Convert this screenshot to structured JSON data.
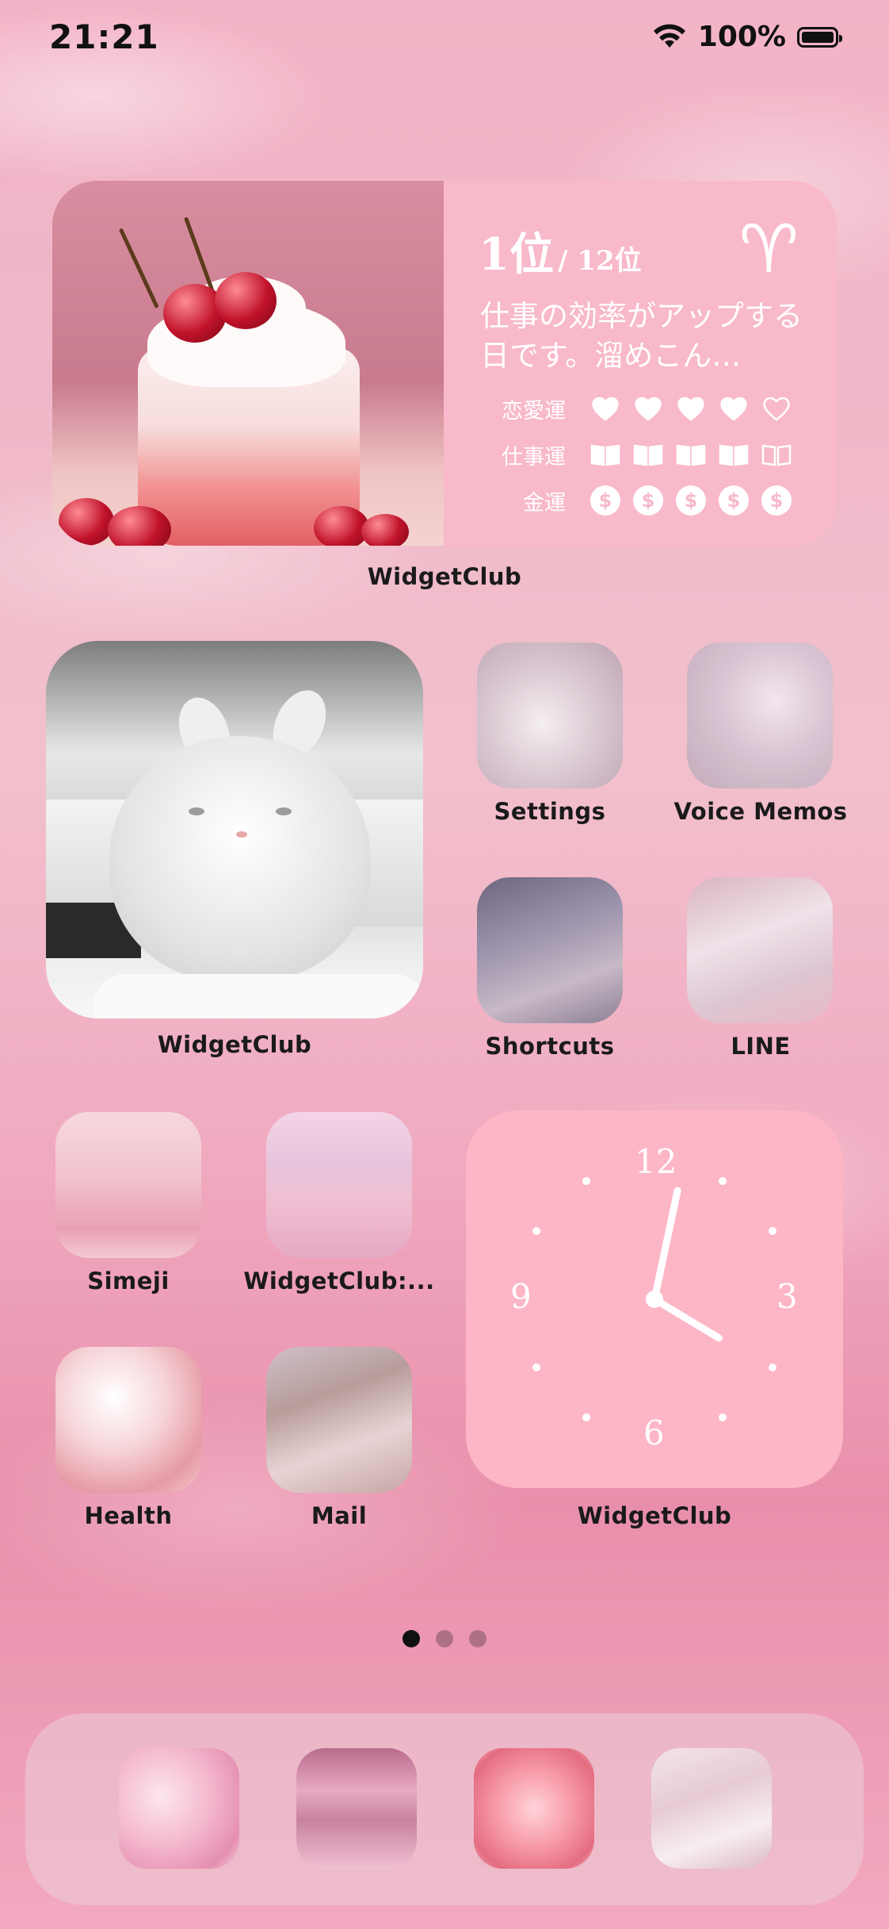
{
  "status_bar": {
    "time": "21:21",
    "battery_percent_label": "100%",
    "battery_level": 1.0,
    "icons": [
      "wifi-icon",
      "battery-icon"
    ]
  },
  "horoscope_widget": {
    "rank": "1位",
    "rank_total": "/ 12位",
    "sign_symbol": "♈",
    "message": "仕事の効率がアップする日です。溜めこん…",
    "rows": [
      {
        "label": "恋愛運",
        "icon": "heart-icon",
        "filled": 4,
        "total": 5
      },
      {
        "label": "仕事運",
        "icon": "book-icon",
        "filled": 4,
        "total": 5
      },
      {
        "label": "金運",
        "icon": "coin-icon",
        "filled": 5,
        "total": 5
      }
    ],
    "coin_glyph": "$",
    "label": "WidgetClub"
  },
  "bunny_widget": {
    "label": "WidgetClub"
  },
  "apps": [
    {
      "id": "settings",
      "label": "Settings"
    },
    {
      "id": "voice-memos",
      "label": "Voice Memos"
    },
    {
      "id": "shortcuts",
      "label": "Shortcuts"
    },
    {
      "id": "line",
      "label": "LINE"
    },
    {
      "id": "simeji",
      "label": "Simeji"
    },
    {
      "id": "widgetclub-2",
      "label": "WidgetClub:..."
    },
    {
      "id": "health",
      "label": "Health"
    },
    {
      "id": "mail",
      "label": "Mail"
    }
  ],
  "clock_widget": {
    "numbers": [
      "12",
      "3",
      "6",
      "9"
    ],
    "hour": 4,
    "minute": 2,
    "label": "WidgetClub"
  },
  "page_dots": {
    "count": 3,
    "active_index": 0
  },
  "dock": {
    "apps": [
      "dock-app-hearts",
      "dock-app-shelf",
      "dock-app-roses",
      "dock-app-table"
    ]
  },
  "colors": {
    "widget_pink": "#f8b9ca",
    "clock_pink": "#fdb6c6",
    "label_text": "#1a1a1a"
  }
}
